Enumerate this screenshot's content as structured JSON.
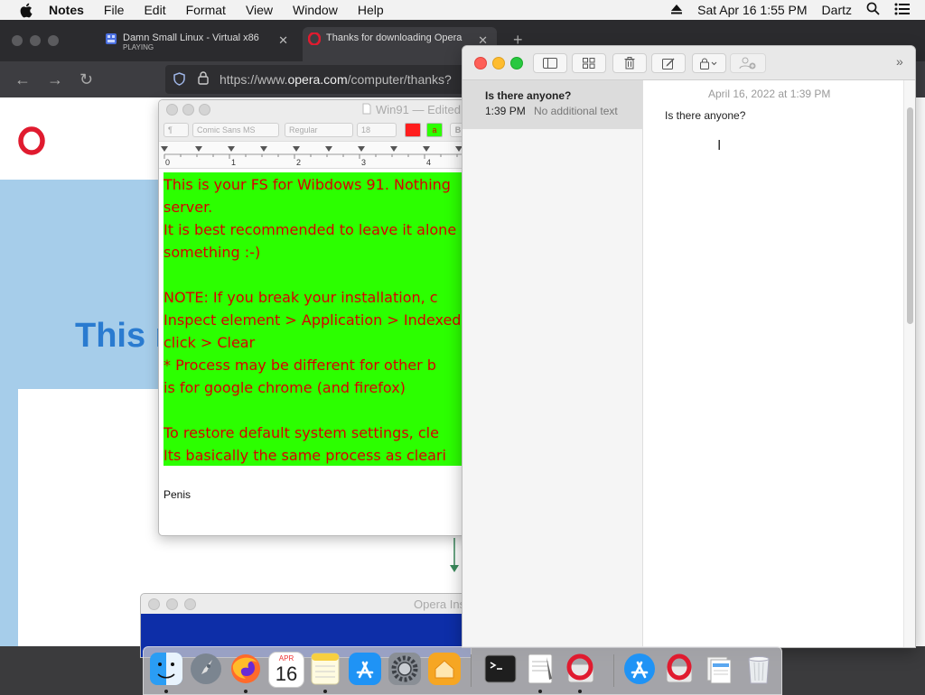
{
  "menubar": {
    "app_name": "Notes",
    "items": [
      "File",
      "Edit",
      "Format",
      "View",
      "Window",
      "Help"
    ],
    "datetime": "Sat Apr 16  1:55 PM",
    "user": "Dartz"
  },
  "browser": {
    "tabs": [
      {
        "title": "Damn Small Linux - Virtual x86",
        "status": "PLAYING"
      },
      {
        "title": "Thanks for downloading Opera"
      }
    ],
    "url_prefix": "https://www.",
    "url_domain": "opera.com",
    "url_path": "/computer/thanks?",
    "page_heading": "This n"
  },
  "textedit": {
    "title": "Win91 — Edited",
    "font": "Comic Sans MS",
    "style": "Regular",
    "size": "18",
    "paragraph": "¶",
    "ruler_labels": [
      "0",
      "1",
      "2",
      "3",
      "4"
    ],
    "document_text": "This is your FS for Wibdows 91. Nothing\nserver.\nIt is best recommended to leave it alone\nsomething :-)\n\nNOTE: If you break your installation, c\nInspect element > Application > Indexed\nclick > Clear\n* Process may be different for other b\nis for google chrome (and firefox)\n\nTo restore default system settings, cle\nIts basically the same process as cleari",
    "after_text": "Penis"
  },
  "installer": {
    "title": "Opera Installer"
  },
  "notes": {
    "list": [
      {
        "title": "Is there anyone?",
        "time": "1:39 PM",
        "preview": "No additional text"
      }
    ],
    "editor": {
      "date": "April 16, 2022 at 1:39 PM",
      "body": "Is there anyone?"
    }
  },
  "dock": {
    "calendar_month": "APR",
    "calendar_day": "16"
  },
  "colors": {
    "doc_background": "#2cff00",
    "doc_text": "#d80000",
    "opera_red": "#e01b2f",
    "page_blue": "#a6cdea"
  }
}
